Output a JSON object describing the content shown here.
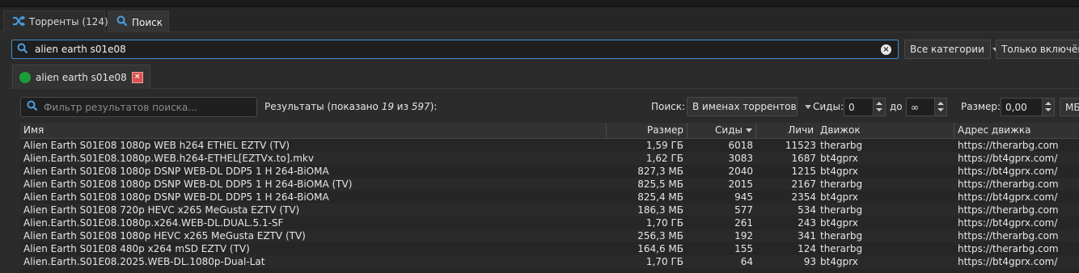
{
  "tabs": [
    {
      "label": "Торренты (124)",
      "icon": "shuffle-icon"
    },
    {
      "label": "Поиск",
      "icon": "search-icon"
    }
  ],
  "search": {
    "query": "alien earth s01e08",
    "clear_icon": "clear-icon"
  },
  "category_select": {
    "value": "Все категории"
  },
  "plugins_select": {
    "value": "Только включённ"
  },
  "result_tab": {
    "label": "alien earth s01e08"
  },
  "filter": {
    "placeholder": "Фильтр результатов поиска..."
  },
  "results_info": {
    "prefix": "Результаты (показано ",
    "shown": "19",
    "mid": " из ",
    "total": "597",
    "suffix": "):"
  },
  "search_in": {
    "label": "Поиск:",
    "value": "В именах торрентов"
  },
  "seeds_filter": {
    "label": "Сиды:",
    "min": "0",
    "to_label": "до",
    "max": "∞"
  },
  "size_filter": {
    "label": "Размер:",
    "min": "0,00",
    "unit": "МБ"
  },
  "table": {
    "headers": {
      "name": "Имя",
      "size": "Размер",
      "seeds": "Сиды",
      "leeches": "Личи",
      "engine": "Движок",
      "engine_url": "Адрес движка"
    },
    "rows": [
      {
        "name": "Alien Earth S01E08 1080p WEB h264 ETHEL EZTV (TV)",
        "size": "1,59 ГБ",
        "seeds": "6018",
        "leeches": "11523",
        "engine": "therarbg",
        "url": "https://therarbg.com"
      },
      {
        "name": "Alien.Earth.S01E08.1080p.WEB.h264-ETHEL[EZTVx.to].mkv",
        "size": "1,62 ГБ",
        "seeds": "3083",
        "leeches": "1687",
        "engine": "bt4gprx",
        "url": "https://bt4gprx.com/"
      },
      {
        "name": "Alien Earth S01E08 1080p DSNP WEB-DL DDP5 1 H 264-BiOMA",
        "size": "827,3 МБ",
        "seeds": "2040",
        "leeches": "1215",
        "engine": "bt4gprx",
        "url": "https://bt4gprx.com/"
      },
      {
        "name": "Alien Earth S01E08 1080p DSNP WEB-DL DDP5 1 H 264-BiOMA (TV)",
        "size": "825,5 МБ",
        "seeds": "2015",
        "leeches": "2167",
        "engine": "therarbg",
        "url": "https://therarbg.com"
      },
      {
        "name": "Alien Earth S01E08 1080p DSNP WEB-DL DDP5 1 H 264-BiOMA",
        "size": "825,4 МБ",
        "seeds": "945",
        "leeches": "2354",
        "engine": "bt4gprx",
        "url": "https://bt4gprx.com/"
      },
      {
        "name": "Alien Earth S01E08 720p HEVC x265 MeGusta EZTV (TV)",
        "size": "186,3 МБ",
        "seeds": "577",
        "leeches": "534",
        "engine": "therarbg",
        "url": "https://therarbg.com"
      },
      {
        "name": "Alien.Earth.S01E08.1080p.x264.WEB-DL.DUAL.5.1-SF",
        "size": "1,70 ГБ",
        "seeds": "261",
        "leeches": "243",
        "engine": "bt4gprx",
        "url": "https://bt4gprx.com/"
      },
      {
        "name": "Alien Earth S01E08 1080p HEVC x265 MeGusta EZTV (TV)",
        "size": "256,3 МБ",
        "seeds": "192",
        "leeches": "341",
        "engine": "therarbg",
        "url": "https://therarbg.com"
      },
      {
        "name": "Alien Earth S01E08 480p x264 mSD EZTV (TV)",
        "size": "164,6 МБ",
        "seeds": "155",
        "leeches": "124",
        "engine": "therarbg",
        "url": "https://therarbg.com"
      },
      {
        "name": "Alien.Earth.S01E08.2025.WEB-DL.1080p-Dual-Lat",
        "size": "1,70 ГБ",
        "seeds": "64",
        "leeches": "93",
        "engine": "bt4gprx",
        "url": "https://bt4gprx.com/"
      }
    ]
  },
  "colors": {
    "accent": "#3d8fd1",
    "background": "#2b2b2b",
    "icon_blue": "#4a9fe0",
    "status_green": "#1a9c3a",
    "close_red": "#d9534f"
  }
}
